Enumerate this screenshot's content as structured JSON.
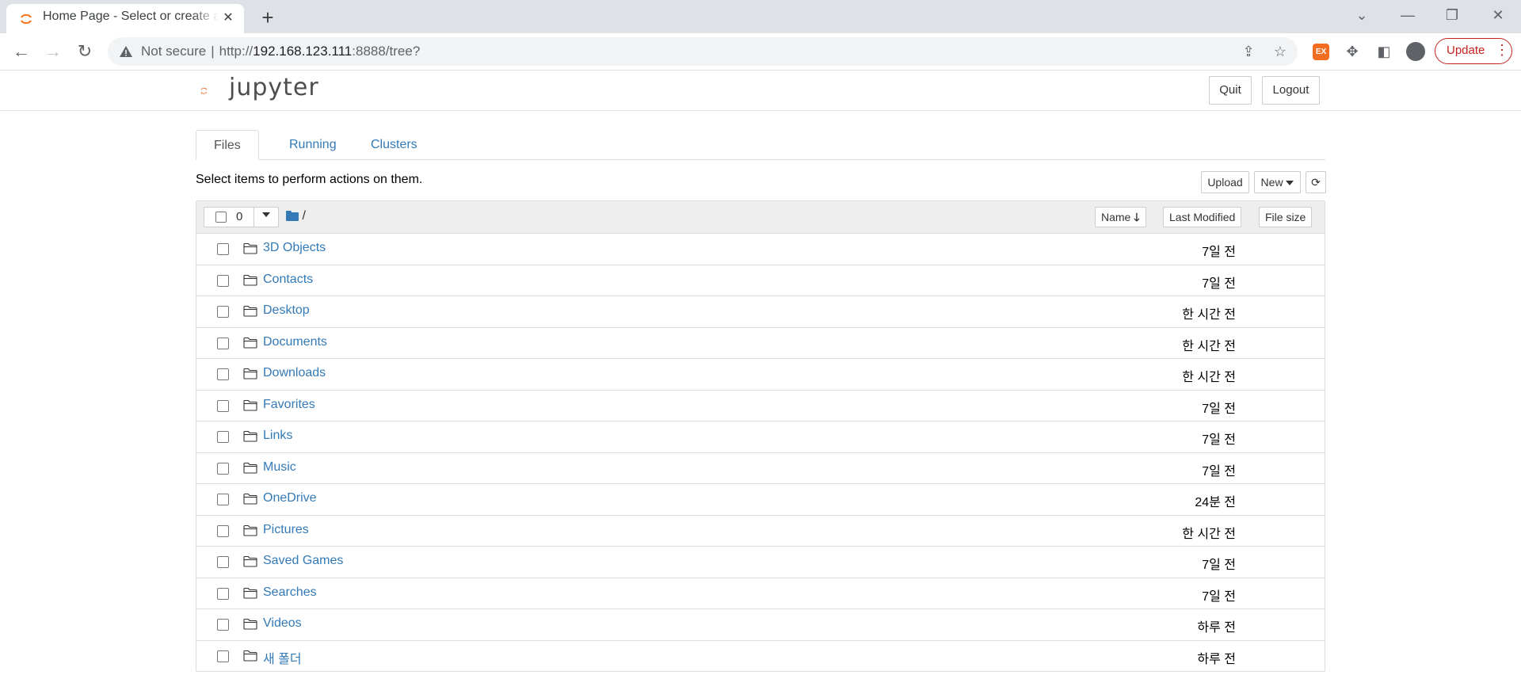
{
  "browser": {
    "tab_title": "Home Page - Select or create a notebook",
    "url_warning": "Not secure",
    "url_scheme": "http://",
    "url_host": "192.168.123.111",
    "url_rest": ":8888/tree?",
    "update_label": "Update",
    "extension_badge": "EX",
    "accent": "#f37726"
  },
  "header": {
    "logo_text": "jupyter",
    "quit_label": "Quit",
    "logout_label": "Logout"
  },
  "tabs": [
    {
      "label": "Files",
      "active": true
    },
    {
      "label": "Running",
      "active": false
    },
    {
      "label": "Clusters",
      "active": false
    }
  ],
  "toolbar": {
    "message": "Select items to perform actions on them.",
    "upload_label": "Upload",
    "new_label": "New"
  },
  "list": {
    "selected_count": "0",
    "breadcrumb": "/",
    "sort_name_label": "Name",
    "sort_modified_label": "Last Modified",
    "sort_size_label": "File size",
    "items": [
      {
        "name": "3D Objects",
        "modified": "7일 전"
      },
      {
        "name": "Contacts",
        "modified": "7일 전"
      },
      {
        "name": "Desktop",
        "modified": "한 시간 전"
      },
      {
        "name": "Documents",
        "modified": "한 시간 전"
      },
      {
        "name": "Downloads",
        "modified": "한 시간 전"
      },
      {
        "name": "Favorites",
        "modified": "7일 전"
      },
      {
        "name": "Links",
        "modified": "7일 전"
      },
      {
        "name": "Music",
        "modified": "7일 전"
      },
      {
        "name": "OneDrive",
        "modified": "24분 전"
      },
      {
        "name": "Pictures",
        "modified": "한 시간 전"
      },
      {
        "name": "Saved Games",
        "modified": "7일 전"
      },
      {
        "name": "Searches",
        "modified": "7일 전"
      },
      {
        "name": "Videos",
        "modified": "하루 전"
      },
      {
        "name": "새 폴더",
        "modified": "하루 전"
      }
    ]
  }
}
